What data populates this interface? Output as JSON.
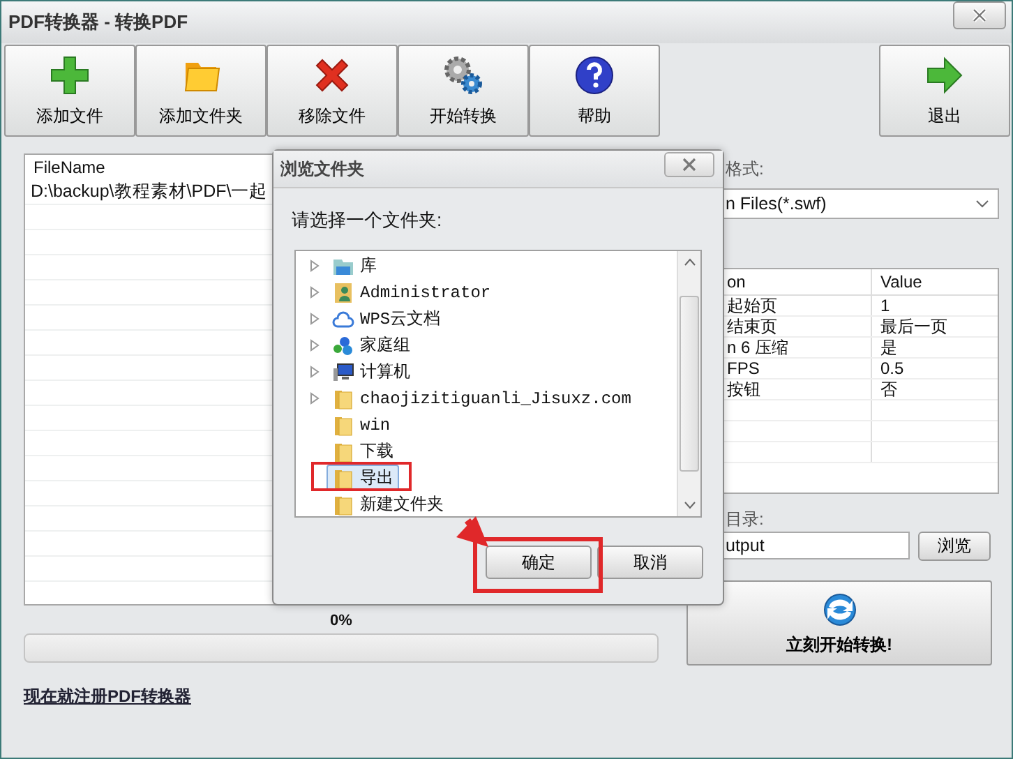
{
  "window": {
    "title": "PDF转换器 - 转换PDF"
  },
  "toolbar": [
    {
      "label": "添加文件"
    },
    {
      "label": "添加文件夹"
    },
    {
      "label": "移除文件"
    },
    {
      "label": "开始转换"
    },
    {
      "label": "帮助"
    }
  ],
  "exit_button": {
    "label": "退出"
  },
  "file_list": {
    "columns": [
      "FileName"
    ],
    "rows": [
      "D:\\backup\\教程素材\\PDF\\一起"
    ]
  },
  "progress": {
    "reading": "0%",
    "level": 0
  },
  "register_link": "现在就注册PDF转换器",
  "format": {
    "label": "格式:",
    "value": "n Files(*.swf)"
  },
  "properties": {
    "columns": [
      "on",
      "Value"
    ],
    "rows": [
      {
        "option": "起始页",
        "value": "1"
      },
      {
        "option": "结束页",
        "value": "最后一页"
      },
      {
        "option": "n 6 压缩",
        "value": "是"
      },
      {
        "option": "FPS",
        "value": "0.5"
      },
      {
        "option": "按钮",
        "value": "否"
      }
    ]
  },
  "output": {
    "label": "目录:",
    "value": "utput",
    "browse": "浏览"
  },
  "convert_button": "立刻开始转换!",
  "dialog": {
    "title": "浏览文件夹",
    "prompt": "请选择一个文件夹:",
    "tree": [
      {
        "label": "库",
        "kind": "library",
        "expandable": true,
        "selected": false
      },
      {
        "label": "Administrator",
        "kind": "user",
        "expandable": true,
        "selected": false
      },
      {
        "label": "WPS云文档",
        "kind": "cloud",
        "expandable": true,
        "selected": false
      },
      {
        "label": "家庭组",
        "kind": "homegroup",
        "expandable": true,
        "selected": false
      },
      {
        "label": "计算机",
        "kind": "computer",
        "expandable": true,
        "selected": false
      },
      {
        "label": "chaojizitiguanli_Jisuxz.com",
        "kind": "folder",
        "expandable": true,
        "selected": false
      },
      {
        "label": "win",
        "kind": "folder",
        "expandable": false,
        "selected": false
      },
      {
        "label": "下载",
        "kind": "folder",
        "expandable": false,
        "selected": false
      },
      {
        "label": "导出",
        "kind": "folder",
        "expandable": false,
        "selected": true
      },
      {
        "label": "新建文件夹",
        "kind": "folder",
        "expandable": false,
        "selected": false
      }
    ],
    "buttons": [
      "确定",
      "取消"
    ]
  }
}
